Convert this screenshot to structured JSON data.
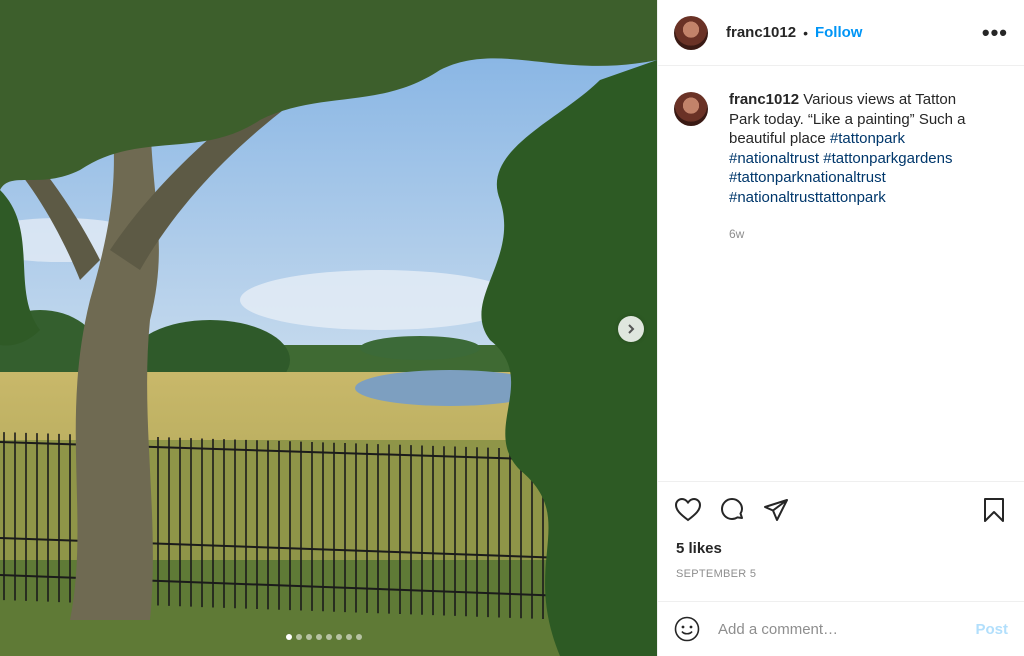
{
  "post": {
    "username": "franc1012",
    "separator": "•",
    "follow_label": "Follow",
    "more_label": "•••",
    "caption_text": "Various views at Tatton Park today. “Like a painting” Such a beautiful place",
    "hashtags": [
      "#tattonpark",
      "#nationaltrust",
      "#tattonparkgardens",
      "#tattonparknationaltrust",
      "#nationaltrusttattonpark"
    ],
    "time_ago": "6w",
    "likes": "5 likes",
    "date": "SEPTEMBER 5"
  },
  "carousel": {
    "total_slides": 8,
    "active_slide": 1
  },
  "comment": {
    "placeholder": "Add a comment…",
    "post_label": "Post"
  },
  "icons": {
    "like": "heart-icon",
    "comment": "comment-icon",
    "share": "send-icon",
    "save": "bookmark-icon",
    "emoji": "smiley-icon",
    "next": "chevron-right-icon"
  },
  "colors": {
    "follow": "#0095f6",
    "hashtag": "#00376b",
    "post_disabled": "#b2dffc",
    "muted": "#8e8e8e"
  }
}
